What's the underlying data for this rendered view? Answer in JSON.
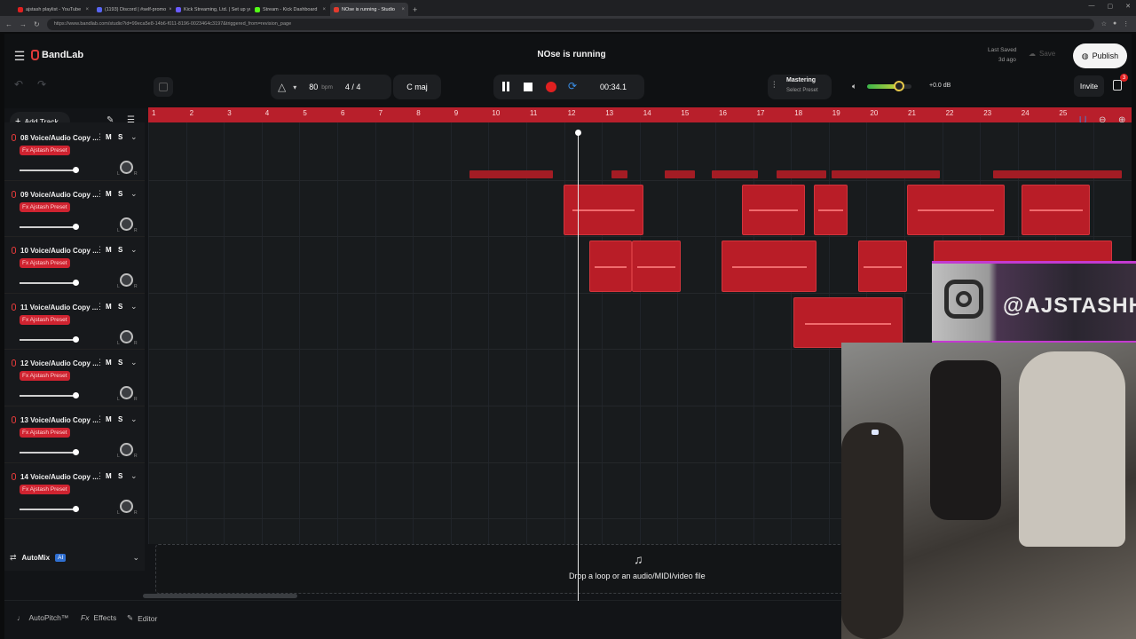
{
  "browser": {
    "tabs": [
      {
        "label": "ajstash playlist - YouTube",
        "color": "#e02020",
        "active": false
      },
      {
        "label": "(1193) Discord | #self-promo",
        "color": "#5865f2",
        "active": false
      },
      {
        "label": "Kick Streaming, Ltd. | Set up your",
        "color": "#6a5cff",
        "active": false
      },
      {
        "label": "Stream - Kick Dashboard",
        "color": "#53fc18",
        "active": false
      },
      {
        "label": "NOse is running - Studio",
        "color": "#e33b2e",
        "active": true
      }
    ],
    "new_tab": "+",
    "url": "https://www.bandlab.com/studio?id=99eca5e8-14b6-f011-8196-0023464c3197&triggered_from=revision_page",
    "window_controls": [
      "—",
      "▢",
      "✕"
    ]
  },
  "header": {
    "logo": "BandLab",
    "project_title": "NOse is running",
    "last_saved_label": "Last Saved",
    "last_saved_value": "3d ago",
    "save_label": "Save",
    "publish_label": "Publish",
    "invite_label": "Invite",
    "notification_count": "3"
  },
  "transport": {
    "bpm": "80",
    "bpm_unit": "bpm",
    "time_signature": "4 / 4",
    "key": "C maj",
    "time": "00:34.1"
  },
  "mastering": {
    "title": "Mastering",
    "preset": "Select Preset",
    "volume_db": "+0.0 dB",
    "volume_level": 0.72
  },
  "toolbar": {
    "add_track": "Add Track"
  },
  "ruler": {
    "bars": [
      "1",
      "2",
      "3",
      "4",
      "5",
      "6",
      "7",
      "8",
      "9",
      "10",
      "11",
      "12",
      "13",
      "14",
      "15",
      "16",
      "17",
      "18",
      "19",
      "20",
      "21",
      "22",
      "23",
      "24",
      "25"
    ]
  },
  "tracks": [
    {
      "name": "08 Voice/Audio Copy ...",
      "fx": "Fx Ajstash Preset",
      "m": "M",
      "s": "S"
    },
    {
      "name": "09 Voice/Audio Copy ...",
      "fx": "Fx Ajstash Preset",
      "m": "M",
      "s": "S"
    },
    {
      "name": "10 Voice/Audio Copy ...",
      "fx": "Fx Ajstash Preset",
      "m": "M",
      "s": "S"
    },
    {
      "name": "11 Voice/Audio Copy ...",
      "fx": "Fx Ajstash Preset",
      "m": "M",
      "s": "S"
    },
    {
      "name": "12 Voice/Audio Copy ...",
      "fx": "Fx Ajstash Preset",
      "m": "M",
      "s": "S"
    },
    {
      "name": "13 Voice/Audio Copy ...",
      "fx": "Fx Ajstash Preset",
      "m": "M",
      "s": "S"
    },
    {
      "name": "14 Voice/Audio Copy ...",
      "fx": "Fx Ajstash Preset",
      "m": "M",
      "s": "S"
    }
  ],
  "pan_labels": {
    "left": "L",
    "right": "R"
  },
  "automix": {
    "label": "AutoMix",
    "badge": "AI"
  },
  "drop_zone": {
    "text": "Drop a loop or an audio/MIDI/video file"
  },
  "bottom": {
    "autopitch": "AutoPitch™",
    "effects": "Effects",
    "editor": "Editor"
  },
  "overlay": {
    "instagram_handle": "@AJSTASHH"
  },
  "colors": {
    "accent_red": "#b81f2b",
    "clip_red": "#b91d27",
    "loop_blue": "#3a8ee6",
    "overlay_magenta": "#c33ad0"
  }
}
